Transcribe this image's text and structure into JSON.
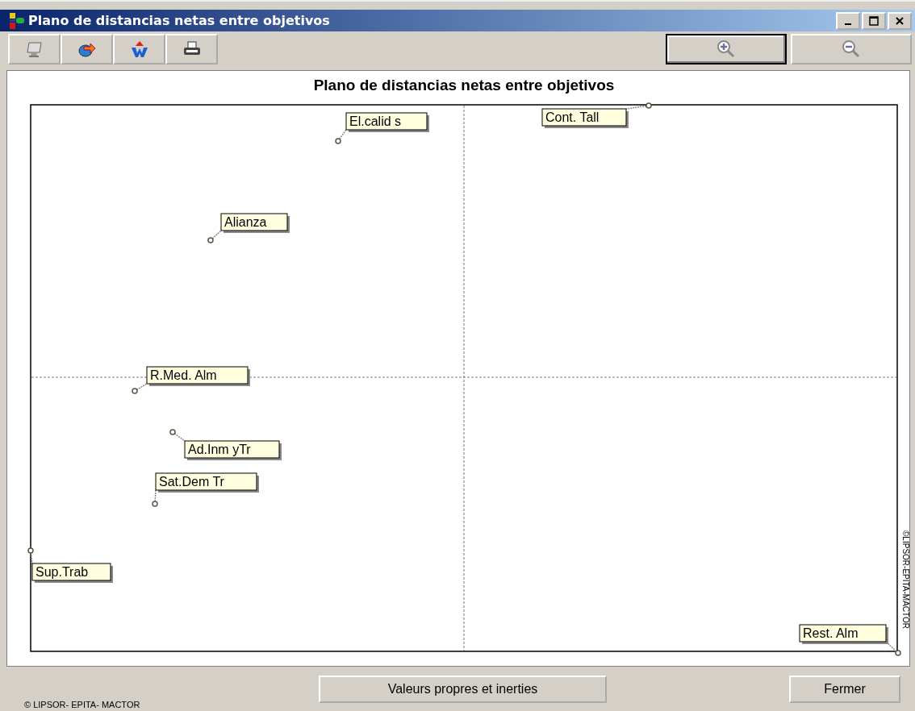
{
  "window": {
    "title": "Plano de distancias netas entre objetivos"
  },
  "chart": {
    "title": "Plano de distancias netas entre objetivos",
    "copyright": "©LIPSOR-EPITA-MACTOR",
    "points": [
      {
        "label": "El.calid s"
      },
      {
        "label": "Cont. Tall"
      },
      {
        "label": "Alianza"
      },
      {
        "label": "R.Med. Alm"
      },
      {
        "label": "Ad.Inm yTr"
      },
      {
        "label": "Sat.Dem Tr"
      },
      {
        "label": "Sup.Trab"
      },
      {
        "label": "Rest. Alm"
      }
    ]
  },
  "footer": {
    "copyright": "© LIPSOR- EPITA- MACTOR",
    "buttons": [
      "Valeurs propres et inerties",
      "Fermer"
    ]
  }
}
